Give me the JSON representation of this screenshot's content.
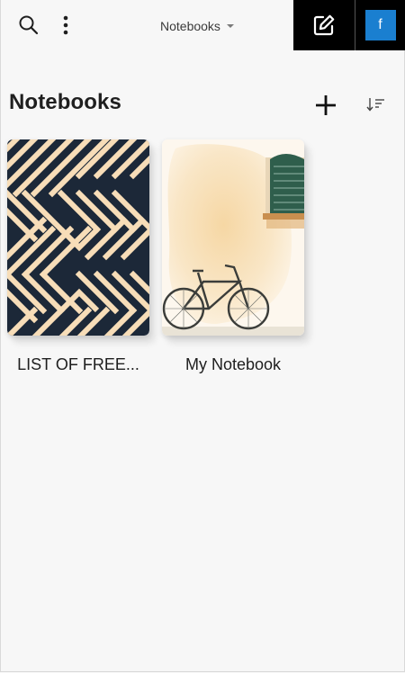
{
  "header": {
    "section_selector": "Notebooks",
    "account_initial": "f"
  },
  "icons": {
    "search": "search-icon",
    "more": "more-vertical-icon",
    "edit": "edit-icon",
    "add": "plus-icon",
    "sort": "sort-icon"
  },
  "colors": {
    "facebook_blue": "#1a7fd0",
    "pattern_dark": "#1c2838",
    "pattern_light": "#f7ddb8"
  },
  "page": {
    "title": "Notebooks"
  },
  "notebooks": [
    {
      "name": "LIST OF FREE..."
    },
    {
      "name": "My Notebook"
    }
  ]
}
